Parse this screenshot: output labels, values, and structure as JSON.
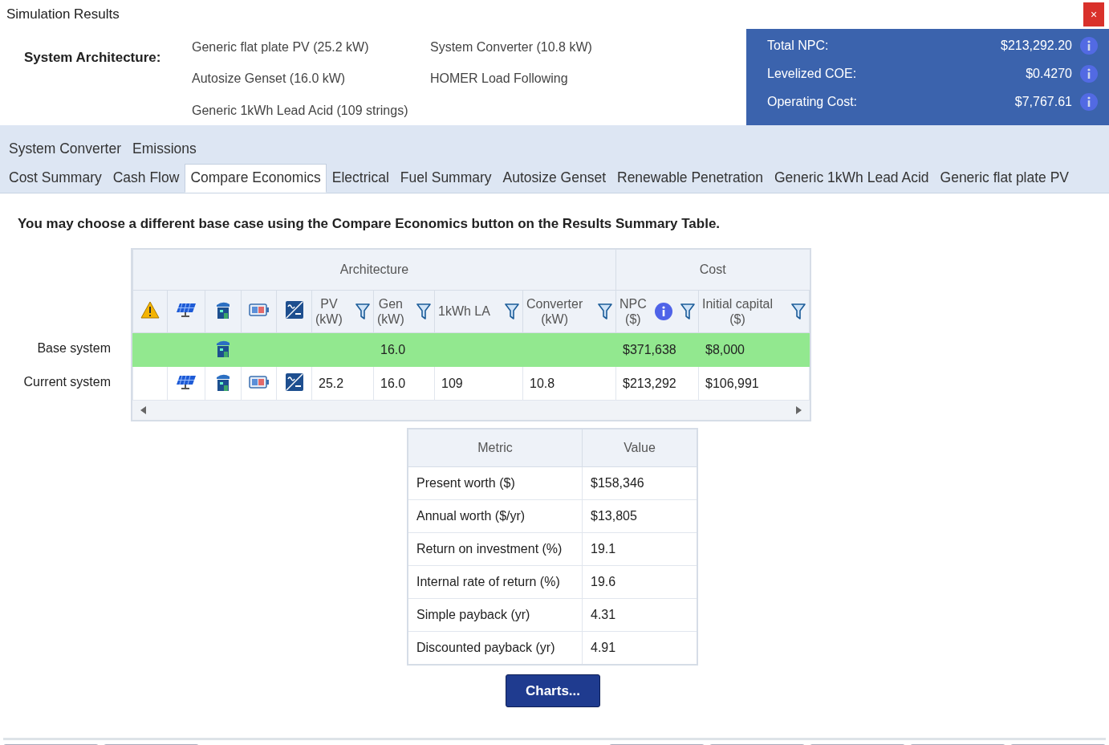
{
  "window": {
    "title": "Simulation Results",
    "close": "×"
  },
  "architecture": {
    "label": "System Architecture:",
    "items": [
      "Generic flat plate PV (25.2 kW)",
      "System Converter (10.8 kW)",
      "Autosize Genset (16.0 kW)",
      "HOMER Load Following",
      "Generic 1kWh Lead Acid (109 strings)"
    ]
  },
  "summary": [
    {
      "label": "Total NPC:",
      "value": "$213,292.20"
    },
    {
      "label": "Levelized COE:",
      "value": "$0.4270"
    },
    {
      "label": "Operating Cost:",
      "value": "$7,767.61"
    }
  ],
  "tab_rows": [
    [
      {
        "label": "System Converter",
        "selected": false
      },
      {
        "label": "Emissions",
        "selected": false
      }
    ],
    [
      {
        "label": "Cost Summary",
        "selected": false
      },
      {
        "label": "Cash Flow",
        "selected": false
      },
      {
        "label": "Compare Economics",
        "selected": true
      },
      {
        "label": "Electrical",
        "selected": false
      },
      {
        "label": "Fuel Summary",
        "selected": false
      },
      {
        "label": "Autosize Genset",
        "selected": false
      },
      {
        "label": "Renewable Penetration",
        "selected": false
      },
      {
        "label": "Generic 1kWh Lead Acid",
        "selected": false
      },
      {
        "label": "Generic flat plate PV",
        "selected": false
      }
    ]
  ],
  "note": "You may choose a different base case using the Compare Economics button on the Results Summary Table.",
  "table": {
    "groups": [
      {
        "label": "Architecture",
        "columns": [
          {
            "kind": "icon"
          },
          {
            "kind": "icon"
          },
          {
            "kind": "icon"
          },
          {
            "kind": "icon"
          },
          {
            "kind": "icon"
          },
          {
            "kind": "text",
            "label": "PV",
            "unit": "(kW)",
            "filter": true
          },
          {
            "kind": "text",
            "label": "Gen",
            "unit": "(kW)",
            "filter": true
          },
          {
            "kind": "text",
            "label": "1kWh LA",
            "filter": true
          },
          {
            "kind": "text",
            "label": "Converter",
            "unit": "(kW)",
            "filter": true
          }
        ]
      },
      {
        "label": "Cost",
        "columns": [
          {
            "kind": "text",
            "label": "NPC",
            "unit": "($)",
            "info": true,
            "filter": true
          },
          {
            "kind": "text",
            "label": "Initial capital",
            "unit": "($)",
            "filter": true
          }
        ]
      }
    ],
    "rows": [
      {
        "label": "Base system",
        "highlighted": true,
        "cells": [
          false,
          false,
          true,
          false,
          false,
          null,
          "16.0",
          null,
          null,
          "$371,638",
          "$8,000"
        ]
      },
      {
        "label": "Current system",
        "highlighted": false,
        "cells": [
          false,
          true,
          true,
          true,
          true,
          "25.2",
          "16.0",
          "109",
          "10.8",
          "$213,292",
          "$106,991"
        ]
      }
    ]
  },
  "metrics": {
    "columns": [
      "Metric",
      "Value"
    ],
    "rows": [
      [
        "Present worth ($)",
        "$158,346"
      ],
      [
        "Annual worth ($/yr)",
        "$13,805"
      ],
      [
        "Return on investment (%)",
        "19.1"
      ],
      [
        "Internal rate of return (%)",
        "19.6"
      ],
      [
        "Simple payback (yr)",
        "4.31"
      ],
      [
        "Discounted payback (yr)",
        "4.91"
      ]
    ]
  },
  "charts_button": "Charts..."
}
